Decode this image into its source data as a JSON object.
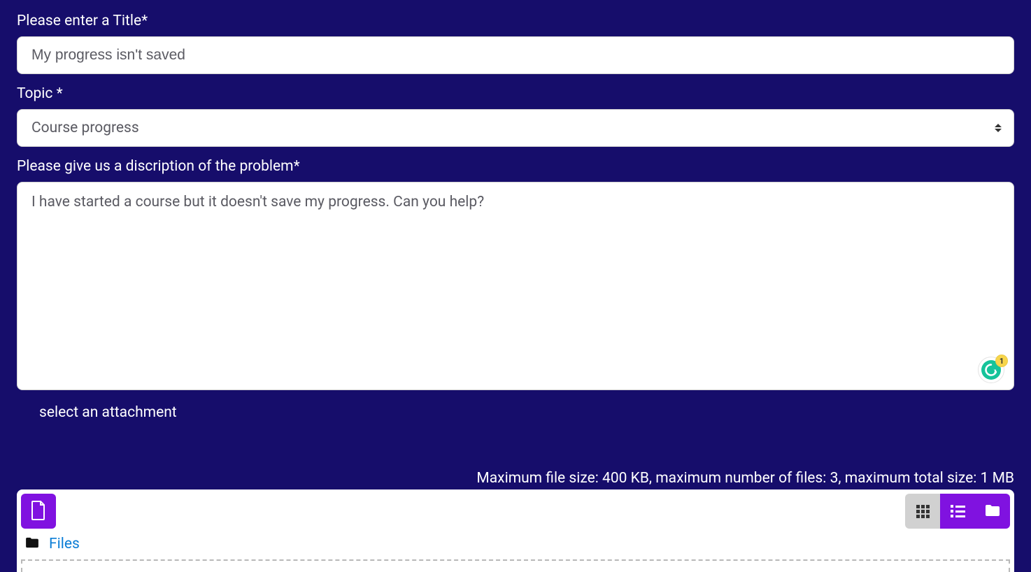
{
  "fields": {
    "title_label": "Please enter a Title*",
    "title_value": "My progress isn't saved",
    "topic_label": "Topic *",
    "topic_value": "Course progress",
    "description_label": "Please give us a discription of the problem*",
    "description_value": "I have started a course but it doesn't save my progress. Can you help?",
    "attachment_label": "select an attachment"
  },
  "grammarly": {
    "count": "1"
  },
  "file_area": {
    "limits_text": "Maximum file size: 400 KB, maximum number of files: 3, maximum total size: 1 MB",
    "breadcrumb": "Files"
  }
}
